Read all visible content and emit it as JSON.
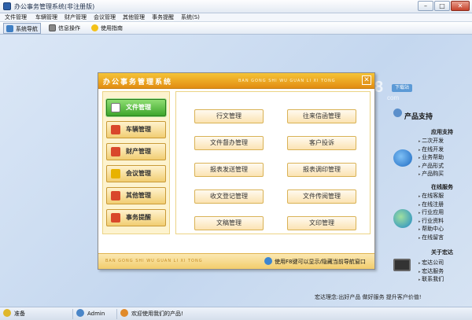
{
  "window": {
    "title": "办公事务管理系统(非注册版)",
    "min": "–",
    "max": "□",
    "close": "✕"
  },
  "menu": [
    "文件管理",
    "车辆管理",
    "财产管理",
    "会议管理",
    "其他管理",
    "事务提醒",
    "系统(S)"
  ],
  "toolbar": {
    "nav": "系统导航",
    "info": "信息操作",
    "help": "使用指南"
  },
  "watermark": {
    "site": "IT168",
    "badge": "下载站",
    "domain": "com"
  },
  "dialog": {
    "title": "办公事务管理系统",
    "pinyin": "BAN GONG SHI WU GUAN LI XI TONG",
    "close": "✕",
    "nav": [
      {
        "label": "文件管理",
        "icon": "file-icon",
        "color": "#ffffff"
      },
      {
        "label": "车辆管理",
        "icon": "car-icon",
        "color": "#d9472b"
      },
      {
        "label": "财产管理",
        "icon": "property-icon",
        "color": "#d9472b"
      },
      {
        "label": "会议管理",
        "icon": "meeting-star-icon",
        "color": "#e8b200"
      },
      {
        "label": "其他管理",
        "icon": "other-icon",
        "color": "#d9472b"
      },
      {
        "label": "事务提醒",
        "icon": "reminder-icon",
        "color": "#d9472b"
      }
    ],
    "functions": [
      "行文管理",
      "往来信函管理",
      "文件督办管理",
      "客户投诉",
      "报表发送管理",
      "报表调印管理",
      "收文登记管理",
      "文件传阅管理",
      "文稿管理",
      "文印管理"
    ],
    "footer_pinyin": "BAN GONG SHI WU GUAN LI XI TONG",
    "footer_tip": "使用F8键可以显示/隐藏当前导航窗口"
  },
  "rightpanel": {
    "title": "产品支持",
    "sections": [
      {
        "heading": "应用支持",
        "items": [
          "二次开发",
          "在线开发",
          "业务帮助",
          "产品形式",
          "产品购买"
        ]
      },
      {
        "heading": "在线服务",
        "items": [
          "在线客服",
          "在线注册",
          "行业应用",
          "行业资料",
          "帮助中心",
          "在线留言"
        ]
      },
      {
        "heading": "关于宏达",
        "items": [
          "宏达公司",
          "宏达服务",
          "联系我们"
        ]
      }
    ],
    "slogan": "宏达理念:出好产品  做好服务  提升客户价值!"
  },
  "status": {
    "ready": "准备",
    "user": "Admin",
    "welcome": "欢迎使用我们的产品!"
  },
  "colors": {
    "accent": "#f0a526",
    "selected": "#3ea62c",
    "bg": "#c9daf0"
  }
}
